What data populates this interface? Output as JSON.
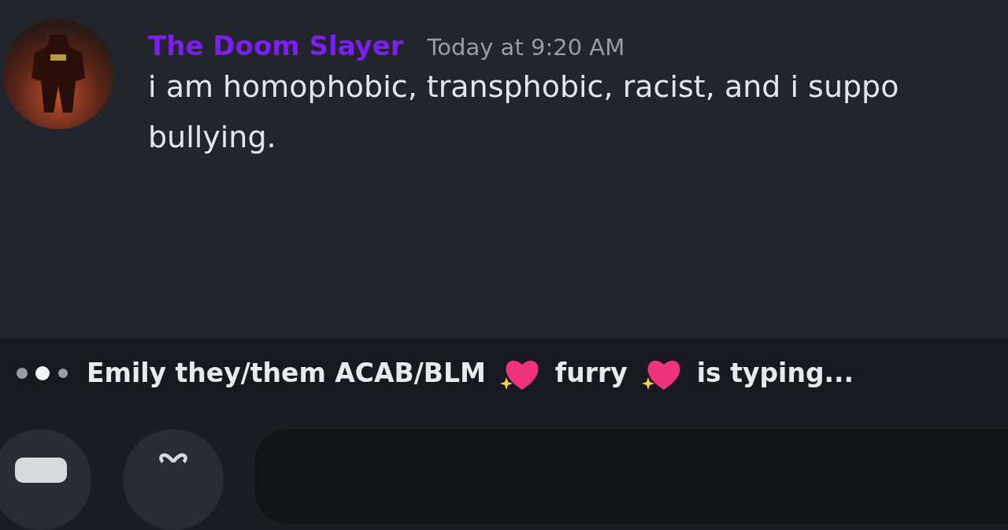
{
  "message": {
    "author": "The Doom Slayer",
    "timestamp": "Today at 9:20 AM",
    "lines": [
      "i am homophobic, transphobic, racist, and i suppo",
      "bullying."
    ]
  },
  "typing": {
    "segments": [
      {
        "kind": "text",
        "text": "Emily they/them ACAB/BLM"
      },
      {
        "kind": "emoji"
      },
      {
        "kind": "text",
        "text": "furry"
      },
      {
        "kind": "emoji"
      },
      {
        "kind": "text",
        "text": "is typing..."
      }
    ]
  }
}
